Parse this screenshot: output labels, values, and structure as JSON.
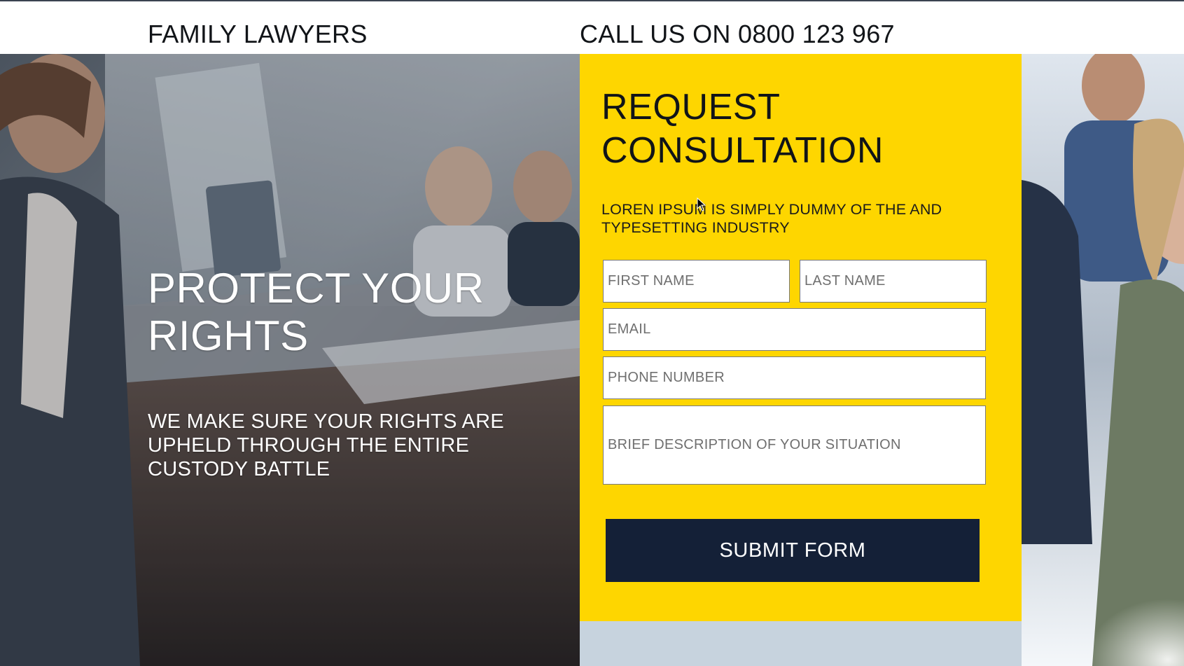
{
  "header": {
    "brand": "FAMILY LAWYERS",
    "phone_cta": "CALL US ON 0800 123 967"
  },
  "hero": {
    "headline": "PROTECT YOUR RIGHTS",
    "subheadline": "WE MAKE SURE YOUR RIGHTS ARE UPHELD THROUGH THE ENTIRE CUSTODY BATTLE"
  },
  "form": {
    "title": "REQUEST CONSULTATION",
    "description": "LOREN IPSUM IS SIMPLY DUMMY OF THE AND TYPESETTING INDUSTRY",
    "fields": {
      "first_name": {
        "placeholder": "FIRST NAME",
        "value": ""
      },
      "last_name": {
        "placeholder": "LAST NAME",
        "value": ""
      },
      "email": {
        "placeholder": "EMAIL",
        "value": ""
      },
      "phone": {
        "placeholder": "PHONE NUMBER",
        "value": ""
      },
      "situation": {
        "placeholder": "BRIEF DESCRIPTION OF YOUR SITUATION",
        "value": ""
      }
    },
    "submit_label": "SUBMIT FORM"
  },
  "colors": {
    "accent_yellow": "#fed600",
    "button_navy": "#142037",
    "text_dark": "#111418",
    "hero_text": "#ffffff"
  },
  "icons": {
    "cursor": "mouse-pointer-icon"
  }
}
